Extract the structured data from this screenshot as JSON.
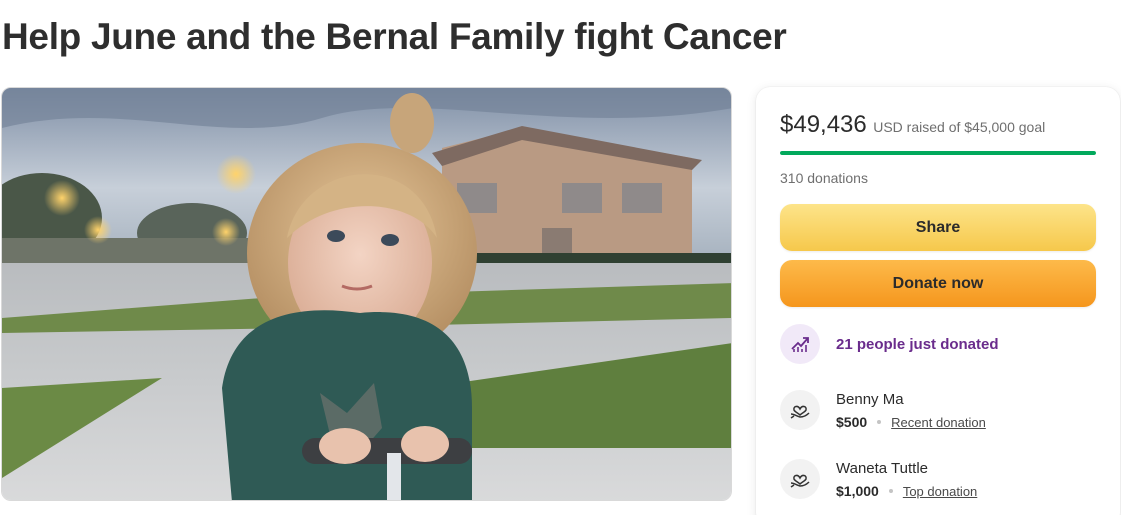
{
  "page": {
    "title": "Help June and the Bernal Family fight Cancer"
  },
  "fundraiser": {
    "amount_raised": "$49,436",
    "goal_text": "USD raised of $45,000 goal",
    "progress_fraction": 1.0,
    "donations_count": "310 donations",
    "share_label": "Share",
    "donate_label": "Donate now",
    "trending_text": "21 people just donated",
    "colors": {
      "progress": "#02a95c",
      "share_button": "#f6c84b",
      "donate_button": "#f5961d",
      "trending_text": "#6a2c8c"
    }
  },
  "donations": [
    {
      "name": "Benny Ma",
      "amount": "$500",
      "tag": "Recent donation",
      "icon": "donation-heart-icon"
    },
    {
      "name": "Waneta Tuttle",
      "amount": "$1,000",
      "tag": "Top donation",
      "icon": "donation-heart-icon"
    }
  ],
  "icons": {
    "trending": "trending-up-icon"
  }
}
